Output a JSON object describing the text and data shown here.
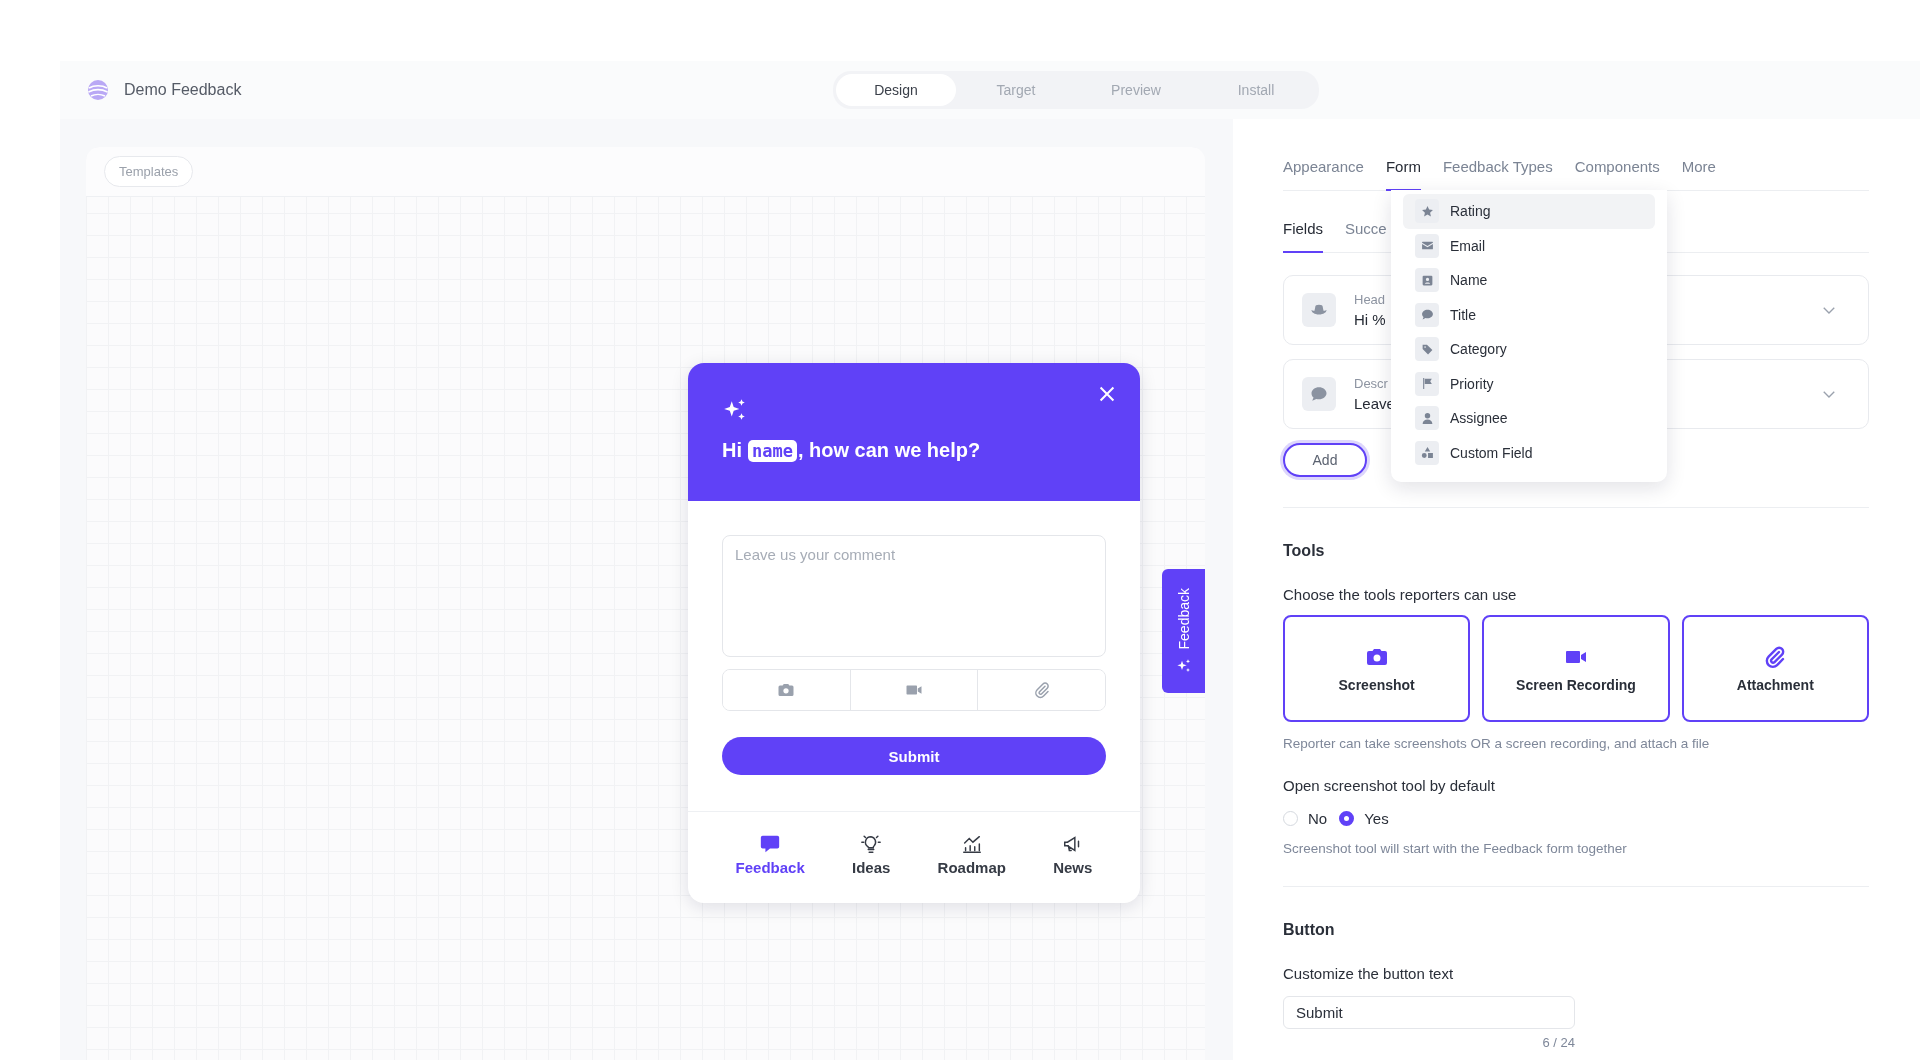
{
  "header": {
    "app_name": "Demo Feedback",
    "steps": [
      {
        "label": "Design",
        "selected": true
      },
      {
        "label": "Target",
        "selected": false
      },
      {
        "label": "Preview",
        "selected": false
      },
      {
        "label": "Install",
        "selected": false
      }
    ]
  },
  "canvas": {
    "templates_button": "Templates",
    "widget": {
      "greeting": {
        "before": "Hi",
        "token": "name",
        "after": ", how can we help?"
      },
      "comment_placeholder": "Leave us your comment",
      "attachment_tools": [
        {
          "kind": "camera"
        },
        {
          "kind": "video"
        },
        {
          "kind": "clip"
        }
      ],
      "submit": "Submit",
      "nav": [
        {
          "label": "Feedback",
          "kind": "feedback",
          "selected": true
        },
        {
          "label": "Ideas",
          "kind": "bulb",
          "selected": false
        },
        {
          "label": "Roadmap",
          "kind": "chart",
          "selected": false
        },
        {
          "label": "News",
          "kind": "megaphone",
          "selected": false
        }
      ]
    },
    "side_tab": "Feedback"
  },
  "settings": {
    "tabs": [
      {
        "label": "Appearance",
        "selected": false
      },
      {
        "label": "Form",
        "selected": true
      },
      {
        "label": "Feedback Types",
        "selected": false
      },
      {
        "label": "Components",
        "selected": false
      },
      {
        "label": "More",
        "selected": false
      }
    ],
    "subtabs": [
      {
        "label": "Fields",
        "selected": true
      },
      {
        "label": "Succe",
        "selected": false
      }
    ],
    "fields": [
      {
        "kind": "hat",
        "label": "Head",
        "value": "Hi %"
      },
      {
        "kind": "chat",
        "label": "Descr",
        "value": "Leave"
      }
    ],
    "add_button": "Add",
    "add_menu": [
      {
        "label": "Rating",
        "kind": "star",
        "selected": true
      },
      {
        "label": "Email",
        "kind": "mail",
        "selected": false
      },
      {
        "label": "Name",
        "kind": "contact",
        "selected": false
      },
      {
        "label": "Title",
        "kind": "chat",
        "selected": false
      },
      {
        "label": "Category",
        "kind": "tag",
        "selected": false
      },
      {
        "label": "Priority",
        "kind": "flag",
        "selected": false
      },
      {
        "label": "Assignee",
        "kind": "person",
        "selected": false
      },
      {
        "label": "Custom Field",
        "kind": "shapes",
        "selected": false
      }
    ],
    "tools": {
      "title": "Tools",
      "prompt": "Choose the tools reporters can use",
      "options": [
        {
          "label": "Screenshot",
          "kind": "camera",
          "selected": true
        },
        {
          "label": "Screen Recording",
          "kind": "video",
          "selected": true
        },
        {
          "label": "Attachment",
          "kind": "clip",
          "selected": true
        }
      ],
      "hint": "Reporter can take screenshots OR a screen recording, and attach a file"
    },
    "default_open": {
      "label": "Open screenshot tool by default",
      "options": [
        {
          "label": "No",
          "selected": false
        },
        {
          "label": "Yes",
          "selected": true
        }
      ],
      "hint": "Screenshot tool will start with the Feedback form together"
    },
    "button_section": {
      "title": "Button",
      "label": "Customize the button text",
      "value": "Submit",
      "counter": "6 / 24"
    }
  }
}
